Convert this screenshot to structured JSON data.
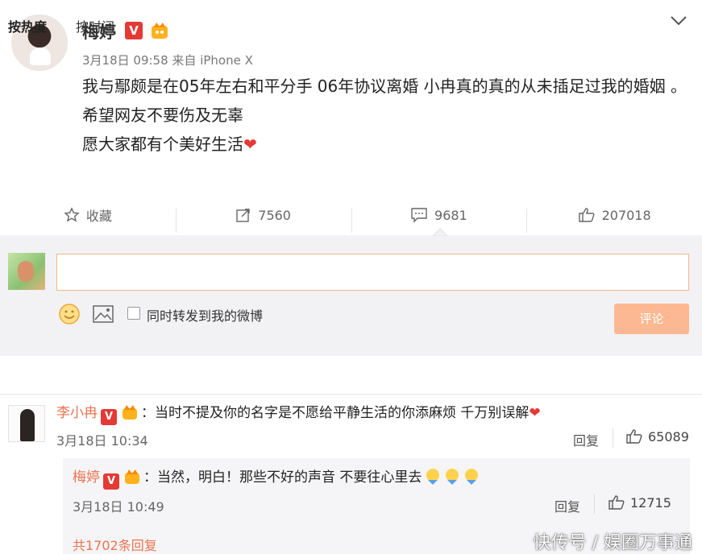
{
  "post": {
    "author": "梅婷",
    "verified_badge": "V",
    "timestamp": "3月18日 09:58",
    "source": "来自 iPhone X",
    "lines": [
      "我与鄢颇是在05年左右和平分手  06年协议离婚 小冉真的真的从未插足过我的婚姻 。",
      "希望网友不要伤及无辜",
      "愿大家都有个美好生活"
    ],
    "heart": "❤",
    "menu_icon": "chevron-down-icon"
  },
  "actions": {
    "favorite": "收藏",
    "repost": "7560",
    "comment": "9681",
    "like": "207018"
  },
  "composer": {
    "placeholder": "",
    "repost_checkbox_label": "同时转发到我的微博",
    "submit": "评论"
  },
  "sort": {
    "hot": "按热度",
    "time": "按时间"
  },
  "comment": {
    "user": "李小冉",
    "badge": "V",
    "text": "当时不提及你的名字是不愿给平静生活的你添麻烦 千万别误解",
    "heart": "❤",
    "time": "3月18日 10:34",
    "reply_label": "回复",
    "likes": "65089"
  },
  "reply": {
    "user": "梅婷",
    "badge": "V",
    "text": "当然，明白！那些不好的声音 不要往心里去",
    "time": "3月18日 10:49",
    "reply_label": "回复",
    "likes": "12715"
  },
  "more_replies": "共1702条回复",
  "watermark": "快传号 / 娱圈万事通",
  "colors": {
    "accent": "#eb7350",
    "verified": "#e53935",
    "submit_bg": "#fbb892"
  }
}
